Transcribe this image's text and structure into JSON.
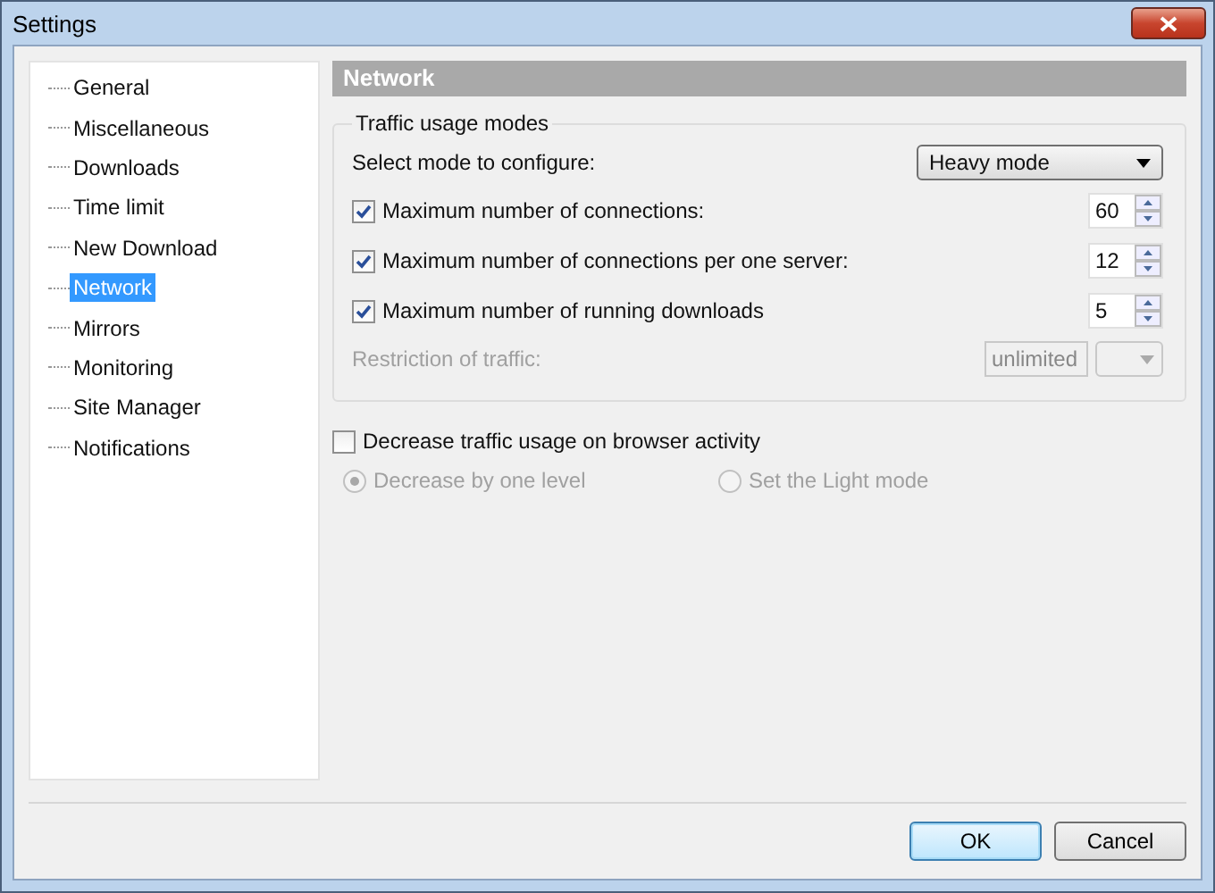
{
  "window": {
    "title": "Settings"
  },
  "sidebar": {
    "items": [
      {
        "label": "General",
        "selected": false
      },
      {
        "label": "Miscellaneous",
        "selected": false
      },
      {
        "label": "Downloads",
        "selected": false
      },
      {
        "label": "Time limit",
        "selected": false
      },
      {
        "label": "New Download",
        "selected": false
      },
      {
        "label": "Network",
        "selected": true
      },
      {
        "label": "Mirrors",
        "selected": false
      },
      {
        "label": "Monitoring",
        "selected": false
      },
      {
        "label": "Site Manager",
        "selected": false
      },
      {
        "label": "Notifications",
        "selected": false
      }
    ]
  },
  "section": {
    "title": "Network",
    "group": {
      "title": "Traffic usage modes",
      "mode_label": "Select mode to configure:",
      "mode_value": "Heavy mode",
      "limits": [
        {
          "label": "Maximum number of connections:",
          "checked": true,
          "value": "60"
        },
        {
          "label": "Maximum number of connections per one server:",
          "checked": true,
          "value": "12"
        },
        {
          "label": "Maximum number of running downloads",
          "checked": true,
          "value": "5"
        }
      ],
      "restriction": {
        "label": "Restriction of traffic:",
        "value": "unlimited",
        "disabled": true
      }
    },
    "browser_activity": {
      "label": "Decrease traffic usage on browser activity",
      "checked": false,
      "options": [
        {
          "label": "Decrease by one level",
          "selected": true,
          "disabled": true
        },
        {
          "label": "Set the Light mode",
          "selected": false,
          "disabled": true
        }
      ]
    }
  },
  "buttons": [
    {
      "label": "OK",
      "default": true
    },
    {
      "label": "Cancel",
      "default": false
    }
  ]
}
